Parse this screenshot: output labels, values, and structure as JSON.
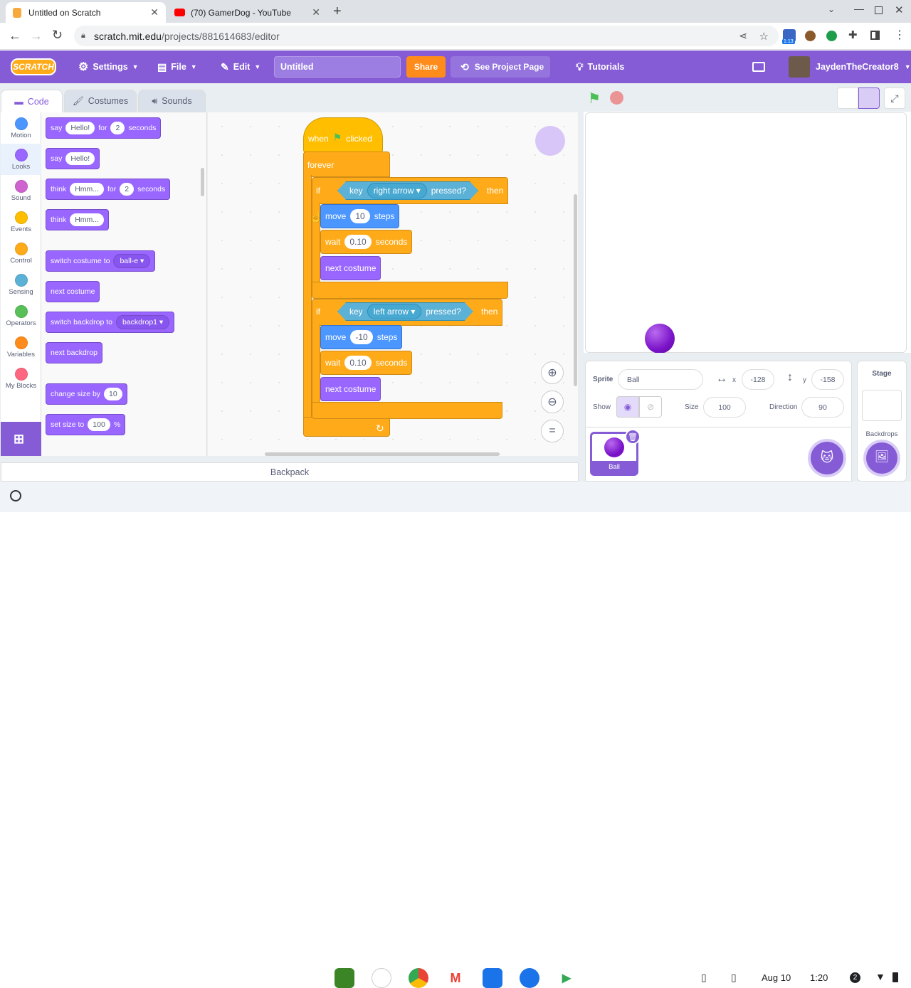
{
  "browser": {
    "tabs": [
      {
        "title": "Untitled on Scratch",
        "active": true
      },
      {
        "title": "(70) GamerDog - YouTube",
        "active": false
      }
    ],
    "url_host": "scratch.mit.edu",
    "url_path": "/projects/881614683/editor",
    "ext_badge": "1:13"
  },
  "menu": {
    "logo": "SCRATCH",
    "settings": "Settings",
    "file": "File",
    "edit": "Edit",
    "title_value": "Untitled",
    "share": "Share",
    "see_project": "See Project Page",
    "tutorials": "Tutorials",
    "username": "JaydenTheCreator8"
  },
  "editor_tabs": {
    "code": "Code",
    "costumes": "Costumes",
    "sounds": "Sounds"
  },
  "categories": [
    {
      "label": "Motion",
      "color": "#4c97ff"
    },
    {
      "label": "Looks",
      "color": "#9966ff"
    },
    {
      "label": "Sound",
      "color": "#cf63cf"
    },
    {
      "label": "Events",
      "color": "#ffbf00"
    },
    {
      "label": "Control",
      "color": "#ffab19"
    },
    {
      "label": "Sensing",
      "color": "#5cb1d6"
    },
    {
      "label": "Operators",
      "color": "#59c059"
    },
    {
      "label": "Variables",
      "color": "#ff8c1a"
    },
    {
      "label": "My Blocks",
      "color": "#ff6680"
    }
  ],
  "palette": {
    "say_for": {
      "say": "say",
      "msg": "Hello!",
      "for": "for",
      "secs": "2",
      "seconds": "seconds"
    },
    "say": {
      "say": "say",
      "msg": "Hello!"
    },
    "think_for": {
      "think": "think",
      "msg": "Hmm...",
      "for": "for",
      "secs": "2",
      "seconds": "seconds"
    },
    "think": {
      "think": "think",
      "msg": "Hmm..."
    },
    "switch_costume": {
      "label": "switch costume to",
      "value": "ball-e"
    },
    "next_costume": "next costume",
    "switch_backdrop": {
      "label": "switch backdrop to",
      "value": "backdrop1"
    },
    "next_backdrop": "next backdrop",
    "change_size": {
      "label": "change size by",
      "value": "10"
    },
    "set_size": {
      "label": "set size to",
      "value": "100",
      "unit": "%"
    }
  },
  "script": {
    "when": "when",
    "clicked": "clicked",
    "forever": "forever",
    "if1": {
      "if": "if",
      "key": "key",
      "key_value": "right arrow",
      "pressed": "pressed?",
      "then": "then"
    },
    "move1": {
      "move": "move",
      "value": "10",
      "steps": "steps"
    },
    "wait1": {
      "wait": "wait",
      "value": "0.10",
      "seconds": "seconds"
    },
    "next1": "next costume",
    "if2": {
      "if": "if",
      "key": "key",
      "key_value": "left arrow",
      "pressed": "pressed?",
      "then": "then"
    },
    "move2": {
      "move": "move",
      "value": "-10",
      "steps": "steps"
    },
    "wait2": {
      "wait": "wait",
      "value": "0.10",
      "seconds": "seconds"
    },
    "next2": "next costume"
  },
  "backpack": "Backpack",
  "sprite_info": {
    "sprite_label": "Sprite",
    "sprite_name": "Ball",
    "x_label": "x",
    "x_value": "-128",
    "y_label": "y",
    "y_value": "-158",
    "show_label": "Show",
    "size_label": "Size",
    "size_value": "100",
    "direction_label": "Direction",
    "direction_value": "90"
  },
  "sprites": [
    {
      "name": "Ball"
    }
  ],
  "stage_pane": {
    "title": "Stage",
    "backdrops": "Backdrops"
  },
  "shelf": {
    "date": "Aug 10",
    "time": "1:20",
    "badge": "2"
  }
}
